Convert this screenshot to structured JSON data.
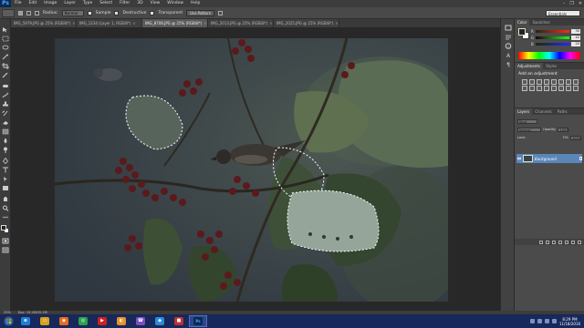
{
  "app": {
    "logo": "Ps",
    "menu": [
      "File",
      "Edit",
      "Image",
      "Layer",
      "Type",
      "Select",
      "Filter",
      "3D",
      "View",
      "Window",
      "Help"
    ],
    "window_controls": [
      "–",
      "❐",
      "✕"
    ]
  },
  "options": {
    "radius_label": "Radius:",
    "mode_value": "Normal",
    "sample_all_label": "Sample",
    "destructive_label": "Destructive",
    "transparent_label": "Transparent",
    "use_pattern_label": "Use Pattern",
    "workspace": "Essentials"
  },
  "tabs": [
    {
      "label": "IMG_5979.JPG @ 25% (RGB/8*)",
      "active": false
    },
    {
      "label": "IMG_1234 (Layer 1, RGB/8*)",
      "active": false
    },
    {
      "label": "IMG_8706.JPG @ 25% (RGB/8*)",
      "active": true
    },
    {
      "label": "IMG_2013.JPG @ 25% (RGB/8*)",
      "active": false
    },
    {
      "label": "IMG_2025.JPG @ 25% (RGB/8*)",
      "active": false
    }
  ],
  "color_panel": {
    "tabs": [
      "Color",
      "Swatches"
    ],
    "channels": [
      {
        "name": "R",
        "value": "30"
      },
      {
        "name": "G",
        "value": "42"
      },
      {
        "name": "B",
        "value": "20"
      }
    ],
    "fg_color": "#1e2a14",
    "bg_color": "#ffffff"
  },
  "adjustments": {
    "tabs": [
      "Adjustments",
      "Styles"
    ],
    "title": "Add an adjustment"
  },
  "layers": {
    "tabs": [
      "Layers",
      "Channels",
      "Paths"
    ],
    "kind": "Kind",
    "blend_mode": "Normal",
    "opacity_label": "Opacity:",
    "opacity_value": "100%",
    "fill_label": "Fill:",
    "fill_value": "100%",
    "lock_label": "Lock:",
    "layer_name": "Background"
  },
  "status": {
    "zoom": "25%",
    "doc": "Doc: 15.2M/15.2M"
  },
  "taskbar": {
    "apps": [
      {
        "name": "ie",
        "glyph": "e",
        "color": "#1e7fd8"
      },
      {
        "name": "explorer",
        "glyph": "▭",
        "color": "#d8a020"
      },
      {
        "name": "firefox",
        "glyph": "◉",
        "color": "#e86a1a"
      },
      {
        "name": "chrome",
        "glyph": "◎",
        "color": "#2aa14a"
      },
      {
        "name": "media",
        "glyph": "▶",
        "color": "#d02020"
      },
      {
        "name": "app6",
        "glyph": "◐",
        "color": "#e8902a"
      },
      {
        "name": "viber",
        "glyph": "☎",
        "color": "#7b4fc2"
      },
      {
        "name": "app8",
        "glyph": "◆",
        "color": "#2a8ad8"
      },
      {
        "name": "app9",
        "glyph": "■",
        "color": "#c03030"
      },
      {
        "name": "photoshop",
        "glyph": "Ps",
        "color": "#0b2a52"
      }
    ],
    "clock_time": "8:29 PM",
    "clock_date": "11/18/2016"
  }
}
